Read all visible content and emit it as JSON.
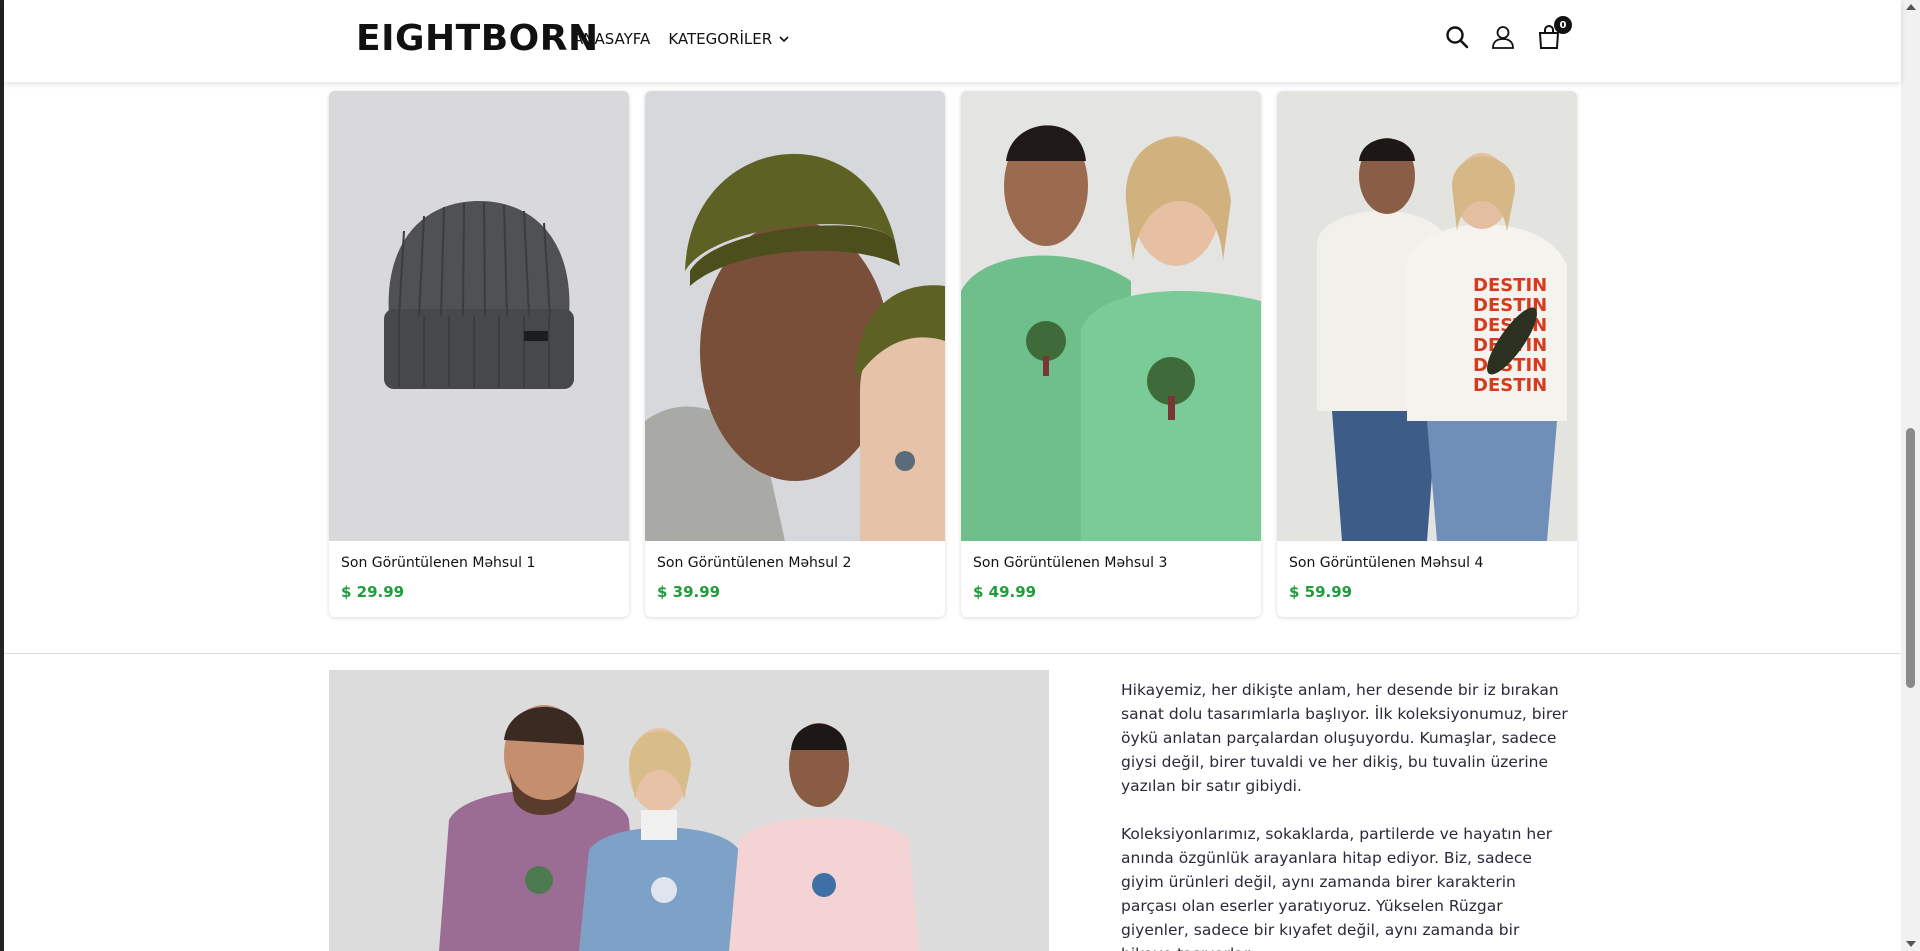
{
  "header": {
    "logo": "EIGHTBORN",
    "nav": [
      {
        "label": "ANASAYFA"
      },
      {
        "label": "KATEGORİLER"
      }
    ],
    "cart_count": "0",
    "icons": [
      "search-icon",
      "user-icon",
      "cart-icon"
    ]
  },
  "products": [
    {
      "title": "Son Görüntülenen Məhsul 1",
      "price": "$ 29.99",
      "image": "charcoal knit beanie"
    },
    {
      "title": "Son Görüntülenen Məhsul 2",
      "price": "$ 39.99",
      "image": "models in olive beanies"
    },
    {
      "title": "Son Görüntülenen Məhsul 3",
      "price": "$ 49.99",
      "image": "models in green hoodies"
    },
    {
      "title": "Son Görüntülenen Məhsul 4",
      "price": "$ 59.99",
      "image": "models in white hoodies"
    }
  ],
  "story": {
    "paragraphs": [
      "Hikayemiz, her dikişte anlam, her desende bir iz bırakan sanat dolu tasarımlarla başlıyor. İlk koleksiyonumuz, birer öykü anlatan parçalardan oluşuyordu. Kumaşlar, sadece giysi değil, birer tuvaldi ve her dikiş, bu tuvalin üzerine yazılan bir satır gibiydi.",
      "Koleksiyonlarımız, sokaklarda, partilerde ve hayatın her anında özgünlük arayanlara hitap ediyor. Biz, sadece giyim ürünleri değil, aynı zamanda birer karakterin parçası olan eserler yaratıyoruz. Yükselen Rüzgar giyenler, sadece bir kıyafet değil, aynı zamanda bir hikaye taşıyorlar."
    ]
  },
  "colors": {
    "price": "#1f9d3a",
    "text": "#2a2a3a"
  }
}
